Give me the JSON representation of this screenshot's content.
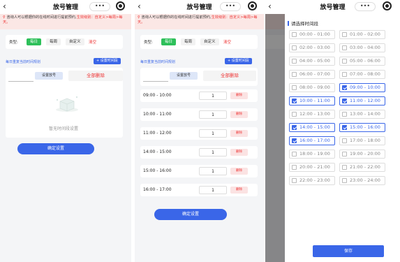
{
  "title": "放号管理",
  "caps_label": "•••",
  "back_glyph": "‹",
  "pin_glyph": "⚲",
  "notice_text": "咨询人可以根据你的在线时间进行提前预约,",
  "notice_red": "生效级别：自定义>每周>每天。",
  "type_label": "类型:",
  "type_options": [
    "每日",
    "每周",
    "自定义"
  ],
  "clear_label": "清空",
  "daily_repeat_label": "每日重复当前时间规划",
  "set_slot_button": "+ 设置时间段",
  "set_number_button": "设置放号",
  "delete_all": "全部删除",
  "empty_text": "暂无时间段设置",
  "confirm_button": "确定设置",
  "slots": [
    {
      "time": "09:00 - 10:00",
      "qty": "1"
    },
    {
      "time": "10:00 - 11:00",
      "qty": "1"
    },
    {
      "time": "11:00 - 12:00",
      "qty": "1"
    },
    {
      "time": "14:00 - 15:00",
      "qty": "1"
    },
    {
      "time": "15:00 - 16:00",
      "qty": "1"
    },
    {
      "time": "16:00 - 17:00",
      "qty": "1"
    }
  ],
  "delete_label": "删除",
  "picker_heading": "请选择时间段",
  "picker_options": [
    {
      "label": "00:00 - 01:00",
      "selected": false
    },
    {
      "label": "01:00 - 02:00",
      "selected": false
    },
    {
      "label": "02:00 - 03:00",
      "selected": false
    },
    {
      "label": "03:00 - 04:00",
      "selected": false
    },
    {
      "label": "04:00 - 05:00",
      "selected": false
    },
    {
      "label": "05:00 - 06:00",
      "selected": false
    },
    {
      "label": "06:00 - 07:00",
      "selected": false
    },
    {
      "label": "07:00 - 08:00",
      "selected": false
    },
    {
      "label": "08:00 - 09:00",
      "selected": false
    },
    {
      "label": "09:00 - 10:00",
      "selected": true
    },
    {
      "label": "10:00 - 11:00",
      "selected": true
    },
    {
      "label": "11:00 - 12:00",
      "selected": true
    },
    {
      "label": "12:00 - 13:00",
      "selected": false
    },
    {
      "label": "13:00 - 14:00",
      "selected": false
    },
    {
      "label": "14:00 - 15:00",
      "selected": true
    },
    {
      "label": "15:00 - 16:00",
      "selected": true
    },
    {
      "label": "16:00 - 17:00",
      "selected": true
    },
    {
      "label": "17:00 - 18:00",
      "selected": false
    },
    {
      "label": "18:00 - 19:00",
      "selected": false
    },
    {
      "label": "19:00 - 20:00",
      "selected": false
    },
    {
      "label": "20:00 - 21:00",
      "selected": false
    },
    {
      "label": "21:00 - 22:00",
      "selected": false
    },
    {
      "label": "22:00 - 23:00",
      "selected": false
    },
    {
      "label": "23:00 - 24:00",
      "selected": false
    }
  ],
  "save_button": "保存",
  "colors": {
    "accent": "#3a66e8",
    "active_chip": "#2ec05a",
    "danger": "#e33333",
    "notice_bg": "#fbe7e5"
  }
}
